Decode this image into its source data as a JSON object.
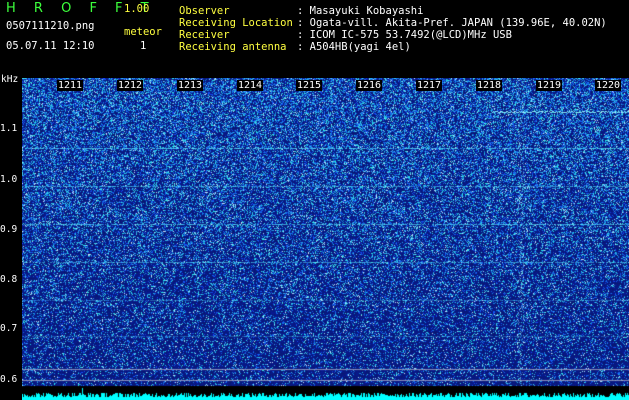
{
  "header": {
    "app_title": "H R O F F T",
    "version": "1.00",
    "filename": "0507111210.png",
    "datetime": "05.07.11 12:10",
    "mode_label": "meteor",
    "mode_count": "1"
  },
  "info": [
    {
      "label": "Observer",
      "value": ": Masayuki Kobayashi"
    },
    {
      "label": "Receiving Location",
      "value": ": Ogata-vill. Akita-Pref. JAPAN (139.96E, 40.02N)"
    },
    {
      "label": "Receiver",
      "value": ": ICOM IC-575 53.7492(@LCD)MHz USB"
    },
    {
      "label": "Receiving antenna",
      "value": ": A504HB(yagi 4el)"
    }
  ],
  "time_ticks": [
    "1211",
    "1212",
    "1213",
    "1214",
    "1215",
    "1216",
    "1217",
    "1218",
    "1219",
    "1220"
  ],
  "freq_unit": "kHz",
  "freq_ticks": [
    "1.1",
    "1.0",
    "0.9",
    "0.8",
    "0.7",
    "0.6"
  ],
  "colors": {
    "background": "#000000",
    "spectrum_base": "#081a7a",
    "title_green": "#3cff3c",
    "label_yellow": "#ffff40",
    "signal_cyan": "#00ffff"
  }
}
